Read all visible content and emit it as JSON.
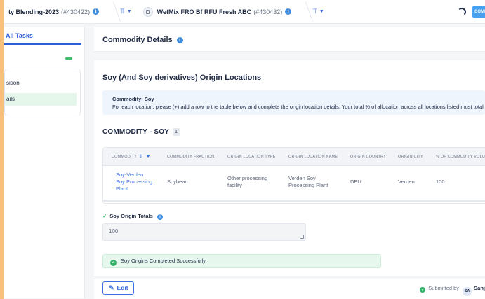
{
  "breadcrumbs": [
    {
      "name": "ty Blending-2023",
      "id": "(#430422)"
    },
    {
      "name": "WetMix FRO Bf RFU Fresh ABC",
      "id": "(#430432)"
    }
  ],
  "topbar": {
    "complete_label": "COMP"
  },
  "left_panel": {
    "tab_label": "All Tasks",
    "items": [
      "sition",
      "ails"
    ]
  },
  "page": {
    "title": "Commodity Details",
    "origins_title": "Soy (And Soy derivatives) Origin Locations",
    "notice_title": "Commodity: Soy",
    "notice_text": "For each location, please (+) add a row to the table below and complete the origin location details. Your total % of allocation across all locations listed must total 1",
    "commodity_heading": "COMMODITY - SOY",
    "commodity_count": "1"
  },
  "table": {
    "headers": [
      "COMMODITY",
      "COMMODITY FRACTION",
      "ORIGIN LOCATION TYPE",
      "ORIGIN LOCATION NAME",
      "ORIGIN COUNTRY",
      "ORIGIN CITY",
      "% OF COMMODITY VOLU"
    ],
    "row": {
      "commodity_lines": [
        "Soy-Verden",
        "Soy Processing",
        "Plant"
      ],
      "fraction": "Soybean",
      "location_type_lines": [
        "Other processing",
        "facility"
      ],
      "location_name_lines": [
        "Verden Soy",
        "Processing Plant"
      ],
      "country": "DEU",
      "city": "Verden",
      "percent": "100"
    }
  },
  "totals": {
    "label": "Soy Origin Totals",
    "value": "100"
  },
  "status": {
    "success_text": "Soy Origins Completed Successfully"
  },
  "footer": {
    "edit_label": "Edit",
    "submitted_label": "Submitted by",
    "avatar_initials": "SA",
    "submitter_name": "Sanj"
  }
}
